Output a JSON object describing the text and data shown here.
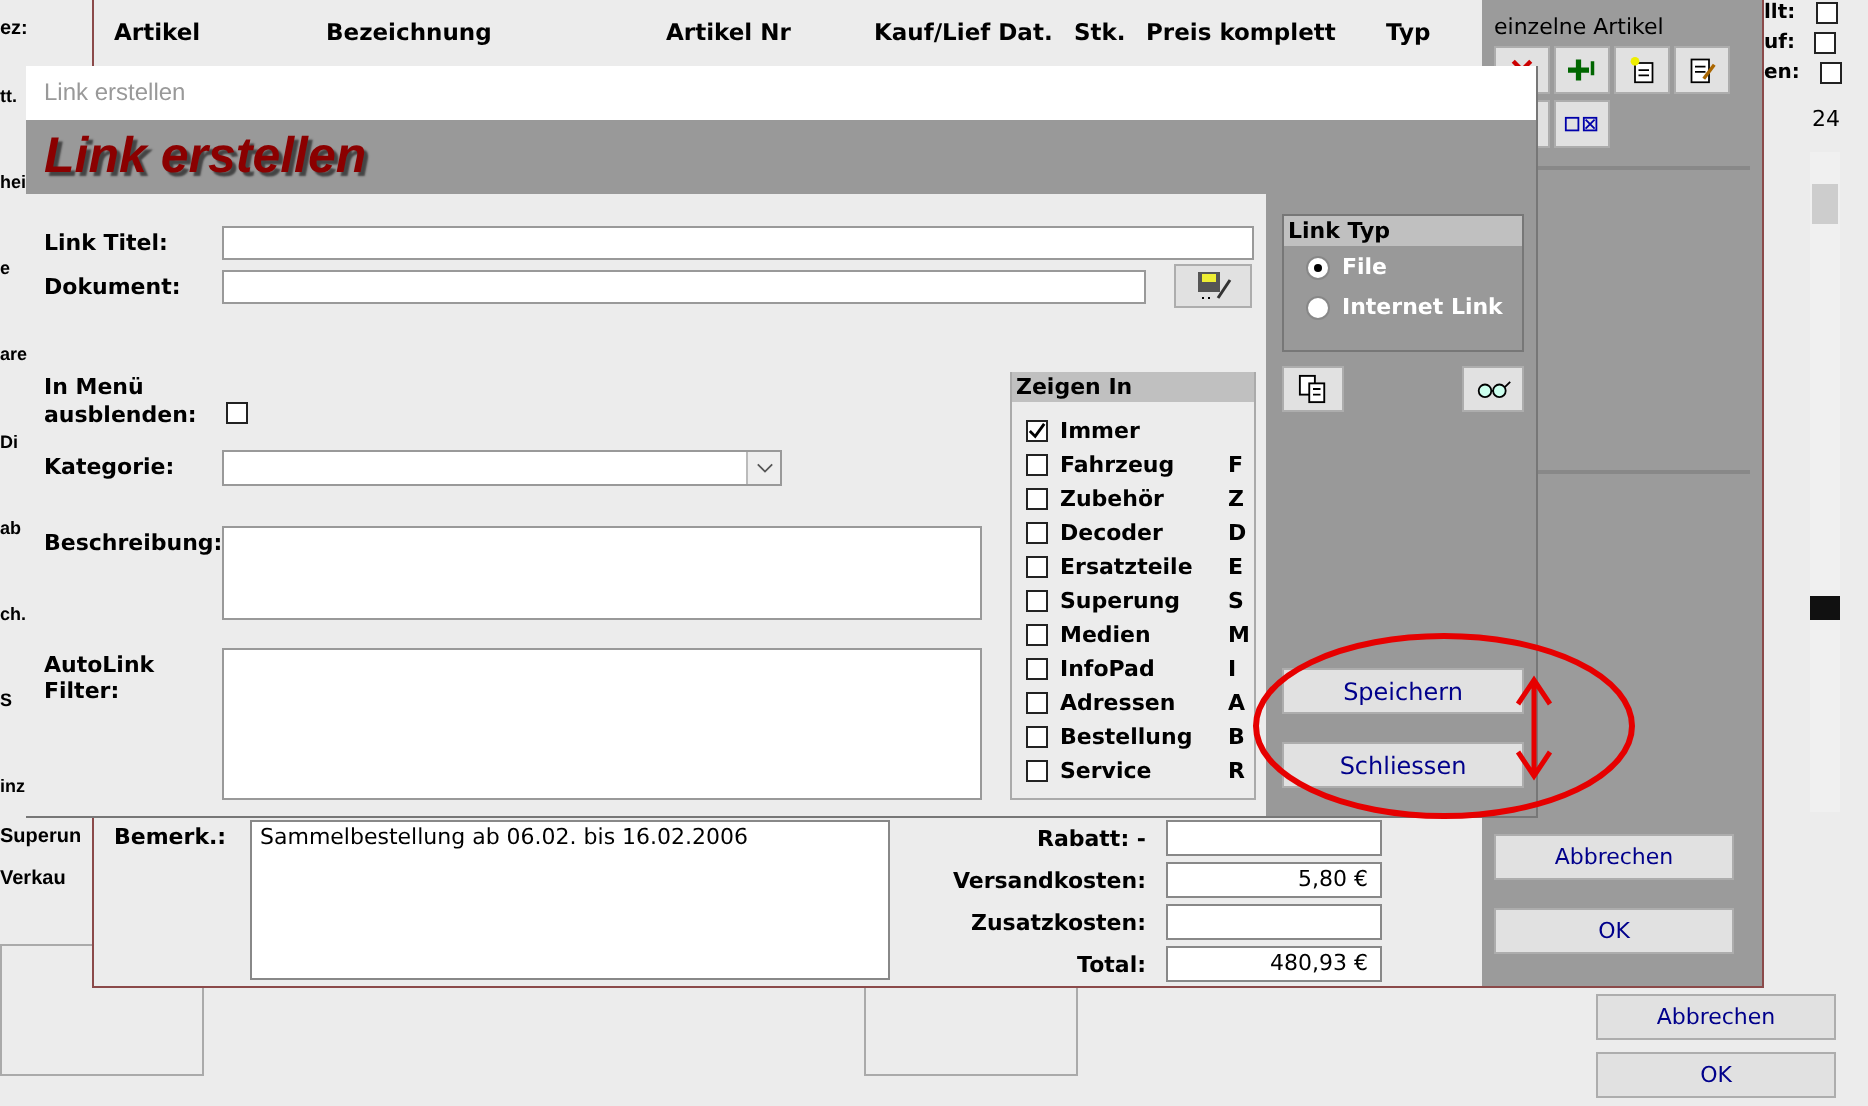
{
  "background_window": {
    "top_labels": [
      "ez:"
    ],
    "side_fragments": [
      "tt.",
      "hei",
      "e",
      "are",
      "Di",
      "ab",
      "ch.",
      "S",
      "inz"
    ],
    "bottom_labels": [
      "Superun",
      "Verkau"
    ],
    "right_checks": [
      {
        "label": "llt:",
        "checked": false
      },
      {
        "label": "uf:",
        "checked": false
      },
      {
        "label": "en:",
        "checked": false
      }
    ],
    "count": "24",
    "buttons": [
      "Abbrechen",
      "OK"
    ]
  },
  "order_window": {
    "columns": [
      "Artikel",
      "Bezeichnung",
      "Artikel Nr",
      "Kauf/Lief Dat.",
      "Stk.",
      "Preis komplett",
      "Typ"
    ],
    "side_title": "einzelne Artikel",
    "remark_label": "Bemerk.:",
    "remark": "Sammelbestellung ab 06.02. bis 16.02.2006",
    "totals": [
      {
        "label": "Rabatt: -"
      },
      {
        "label": "Versandkosten:",
        "value": "5,80 €"
      },
      {
        "label": "Zusatzkosten:"
      },
      {
        "label": "Total:",
        "value": "480,93 €"
      }
    ],
    "buttons": [
      "Abbrechen",
      "OK"
    ]
  },
  "dialog": {
    "title": "Link erstellen",
    "heading": "Link erstellen",
    "fields": [
      {
        "label": "Link Titel:",
        "kind": "text"
      },
      {
        "label": "Dokument:",
        "kind": "file"
      },
      {
        "label": "In Menü ausblenden:",
        "kind": "check",
        "checked": false
      },
      {
        "label": "Kategorie:",
        "kind": "select"
      },
      {
        "label": "Beschreibung:",
        "kind": "area"
      },
      {
        "label": "AutoLink Filter:",
        "kind": "area"
      }
    ],
    "show_in": {
      "title": "Zeigen In",
      "items": [
        {
          "label": "Immer",
          "checked": true
        },
        {
          "label": "Fahrzeug",
          "key": "F",
          "checked": false
        },
        {
          "label": "Zubehör",
          "key": "Z",
          "checked": false
        },
        {
          "label": "Decoder",
          "key": "D",
          "checked": false
        },
        {
          "label": "Ersatzteile",
          "key": "E",
          "checked": false
        },
        {
          "label": "Superung",
          "key": "S",
          "checked": false
        },
        {
          "label": "Medien",
          "key": "M",
          "checked": false
        },
        {
          "label": "InfoPad",
          "key": "I",
          "checked": false
        },
        {
          "label": "Adressen",
          "key": "A",
          "checked": false
        },
        {
          "label": "Bestellung",
          "key": "B",
          "checked": false
        },
        {
          "label": "Service",
          "key": "R",
          "checked": false
        }
      ]
    },
    "link_type": {
      "title": "Link Typ",
      "options": [
        {
          "label": "File",
          "selected": true
        },
        {
          "label": "Internet Link",
          "selected": false
        }
      ]
    },
    "buttons": [
      "Speichern",
      "Schliessen"
    ]
  }
}
